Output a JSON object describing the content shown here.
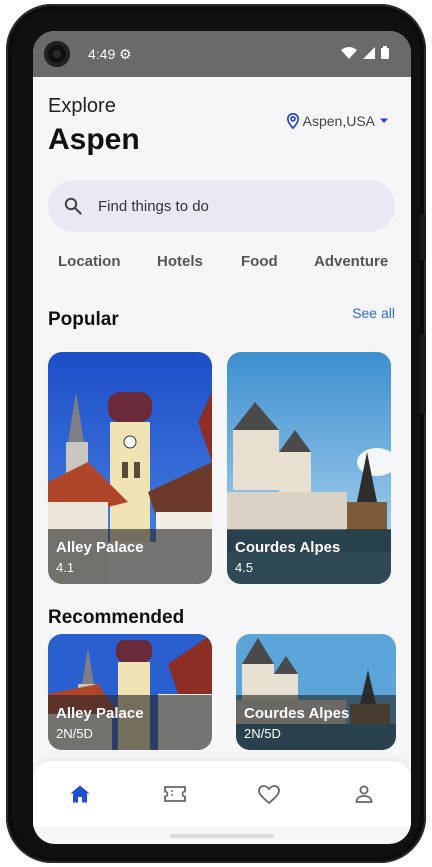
{
  "status_bar": {
    "time": "4:49",
    "icons": [
      "settings-icon",
      "wifi-icon",
      "signal-icon",
      "battery-icon"
    ]
  },
  "header": {
    "greeting": "Explore",
    "city": "Aspen",
    "location": "Aspen,USA",
    "accent_color": "#1f3fd6"
  },
  "search": {
    "placeholder": "Find things to do"
  },
  "categories": [
    {
      "label": "Location"
    },
    {
      "label": "Hotels"
    },
    {
      "label": "Food"
    },
    {
      "label": "Adventure"
    }
  ],
  "popular": {
    "title": "Popular",
    "see_all": "See all",
    "items": [
      {
        "name": "Alley Palace",
        "rating": "4.1"
      },
      {
        "name": "Courdes Alpes",
        "rating": "4.5"
      }
    ]
  },
  "recommended": {
    "title": "Recommended",
    "items": [
      {
        "name": "Alley Palace",
        "duration": "2N/5D"
      },
      {
        "name": "Courdes Alpes",
        "duration": "2N/5D"
      }
    ]
  },
  "bottom_nav": {
    "items": [
      "home-icon",
      "ticket-icon",
      "heart-icon",
      "profile-icon"
    ],
    "active_color": "#1f4fd1",
    "inactive_color": "#666666"
  }
}
